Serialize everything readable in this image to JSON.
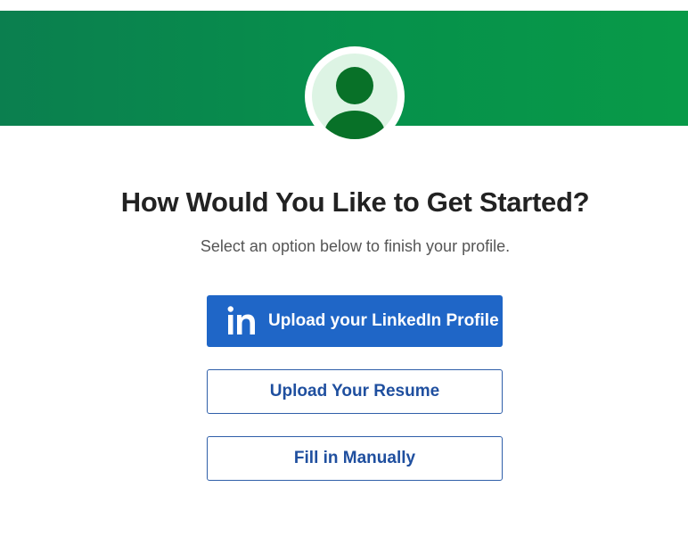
{
  "banner": {
    "accent_color": "#0a8f4c"
  },
  "avatar": {
    "icon": "user-avatar-icon",
    "icon_color": "#087128",
    "background_color": "#ddf4e4"
  },
  "page": {
    "title": "How Would You Like to Get Started?",
    "subtitle": "Select an option below to finish your profile."
  },
  "actions": {
    "linkedin_label": "Upload your LinkedIn Profile",
    "linkedin_icon": "linkedin-icon",
    "linkedin_color": "#1f66c7",
    "resume_label": "Upload Your Resume",
    "manual_label": "Fill in Manually"
  }
}
